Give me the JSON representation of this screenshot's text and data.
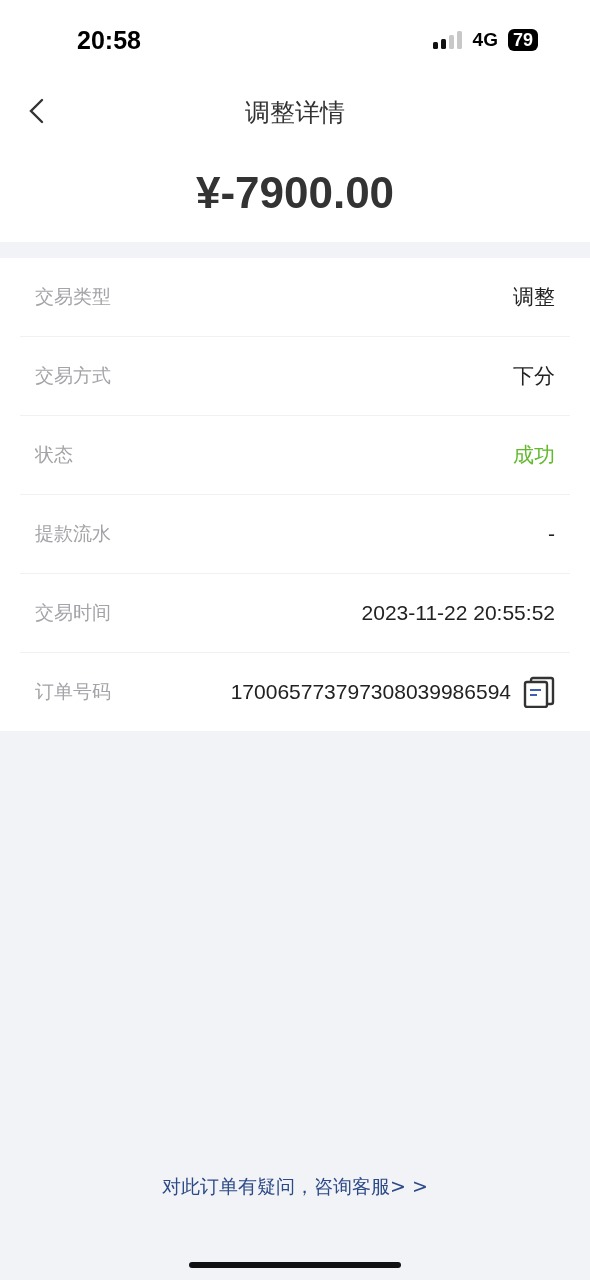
{
  "status_bar": {
    "time": "20:58",
    "network": "4G",
    "battery": "79"
  },
  "nav": {
    "title": "调整详情"
  },
  "amount": "¥-7900.00",
  "rows": [
    {
      "label": "交易类型",
      "value": "调整",
      "kind": "text"
    },
    {
      "label": "交易方式",
      "value": "下分",
      "kind": "text"
    },
    {
      "label": "状态",
      "value": "成功",
      "kind": "status"
    },
    {
      "label": "提款流水",
      "value": "-",
      "kind": "text"
    },
    {
      "label": "交易时间",
      "value": "2023-11-22 20:55:52",
      "kind": "text"
    },
    {
      "label": "订单号码",
      "value": "170065773797308039986594",
      "kind": "copy"
    }
  ],
  "footer_link": "对此订单有疑问，咨询客服> >"
}
